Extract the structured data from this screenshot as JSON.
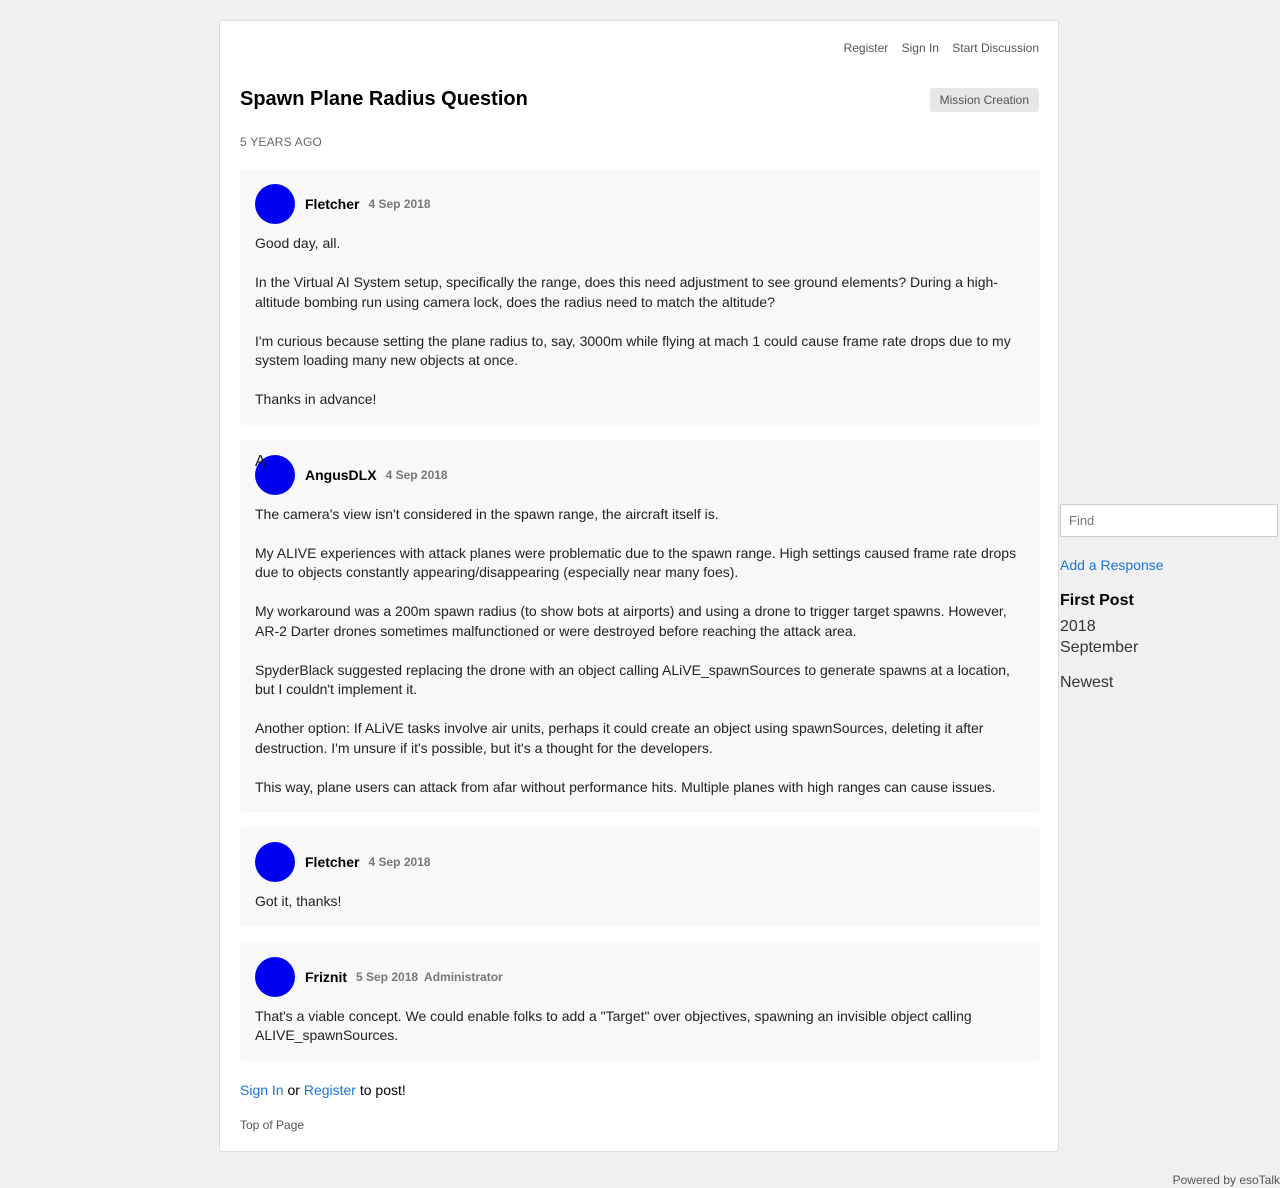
{
  "nav": {
    "register": "Register",
    "sign_in": "Sign In",
    "start_discussion": "Start Discussion"
  },
  "conversation": {
    "title": "Spawn Plane Radius Question",
    "channel": "Mission Creation",
    "age": "5 YEARS AGO"
  },
  "posts": [
    {
      "author": "Fletcher",
      "date": "4 Sep 2018",
      "role": "",
      "avatar_letter": "",
      "paragraphs": [
        "Good day, all.",
        "In the Virtual AI System setup, specifically the range, does this need adjustment to see ground elements? During a high-altitude bombing run using camera lock, does the radius need to match the altitude?",
        "I'm curious because setting the plane radius to, say, 3000m while flying at mach 1 could cause frame rate drops due to my system loading many new objects at once.",
        "Thanks in advance!"
      ]
    },
    {
      "author": "AngusDLX",
      "date": "4 Sep 2018",
      "role": "",
      "avatar_letter": "A",
      "paragraphs": [
        "The camera's view isn't considered in the spawn range, the aircraft itself is.",
        "My ALIVE experiences with attack planes were problematic due to the spawn range. High settings caused frame rate drops due to objects constantly appearing/disappearing (especially near many foes).",
        "My workaround was a 200m spawn radius (to show bots at airports) and using a drone to trigger target spawns. However, AR-2 Darter drones sometimes malfunctioned or were destroyed before reaching the attack area.",
        "SpyderBlack suggested replacing the drone with an object calling ALiVE_spawnSources to generate spawns at a location, but I couldn't implement it.",
        "Another option: If ALiVE tasks involve air units, perhaps it could create an object using spawnSources, deleting it after destruction. I'm unsure if it's possible, but it's a thought for the developers.",
        "This way, plane users can attack from afar without performance hits. Multiple planes with high ranges can cause issues."
      ]
    },
    {
      "author": "Fletcher",
      "date": "4 Sep 2018",
      "role": "",
      "avatar_letter": "",
      "paragraphs": [
        "Got it, thanks!"
      ]
    },
    {
      "author": "Friznit",
      "date": "5 Sep 2018",
      "role": "Administrator",
      "avatar_letter": "",
      "paragraphs": [
        "That's a viable concept. We could enable folks to add a \"Target\" over objectives, spawning an invisible object calling ALIVE_spawnSources."
      ]
    }
  ],
  "reply_hint": {
    "sign_in": "Sign In",
    "or": " or ",
    "register": "Register",
    "suffix": " to post!"
  },
  "top_of_page": "Top of Page",
  "sidebar": {
    "search_placeholder": "Find",
    "add_response": "Add a Response",
    "first_post": "First Post",
    "year": "2018",
    "month": "September",
    "newest": "Newest"
  },
  "footer": {
    "powered_by": "Powered by esoTalk"
  },
  "colors": {
    "avatar": "#0000f0",
    "link": "#1a73d9",
    "post_bg": "#f8f8f8",
    "page_bg": "#f0f0f0"
  },
  "icons": {
    "avatar": "user-avatar-icon"
  }
}
